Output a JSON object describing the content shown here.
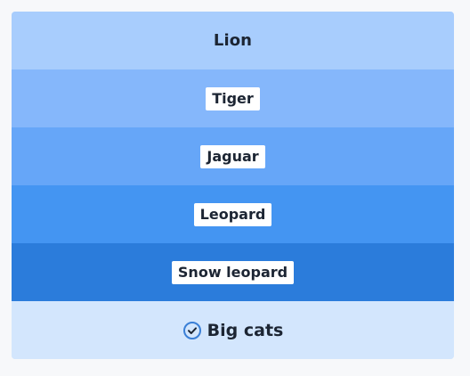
{
  "layers": [
    {
      "label": "Lion",
      "style": "plain",
      "color": "#a8cdfd"
    },
    {
      "label": "Tiger",
      "style": "chip",
      "color": "#85b7fb"
    },
    {
      "label": "Jaguar",
      "style": "chip",
      "color": "#66a6f8"
    },
    {
      "label": "Leopard",
      "style": "chip",
      "color": "#4495f2"
    },
    {
      "label": "Snow leopard",
      "style": "chip",
      "color": "#2b7cdb"
    }
  ],
  "footer": {
    "label": "Big cats",
    "icon": "check-circle-icon",
    "background": "#d3e6fd",
    "icon_color": "#3a7fd6"
  }
}
